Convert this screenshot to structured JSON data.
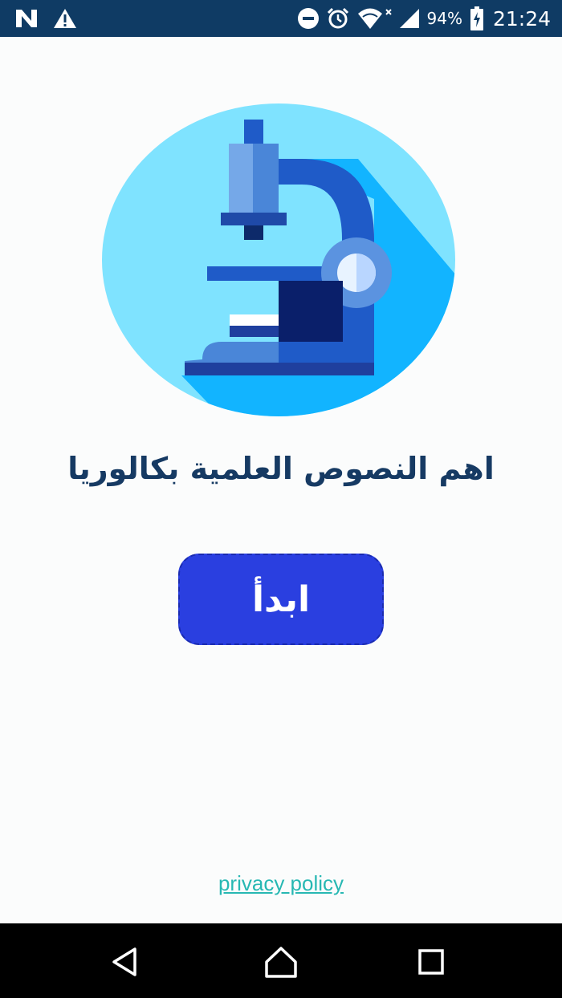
{
  "status_bar": {
    "battery_percent": "94%",
    "time": "21:24",
    "icons": [
      "n-logo-icon",
      "warning-icon",
      "do-not-disturb-icon",
      "alarm-icon",
      "wifi-icon",
      "cellular-signal-icon",
      "battery-charging-icon"
    ]
  },
  "hero": {
    "icon": "microscope-icon"
  },
  "main": {
    "title": "اهم النصوص العلمية بكالوريا",
    "start_label": "ابدأ",
    "privacy_label": "privacy policy"
  },
  "nav_bar": {
    "icons": [
      "back-icon",
      "home-icon",
      "recents-icon"
    ]
  },
  "colors": {
    "status_bar": "#0f3b64",
    "background": "#fbfcfc",
    "title": "#163a63",
    "button": "#2a3fe0",
    "link": "#27b8b3",
    "circle": "#7fe3ff",
    "circle_shadow": "#12b4ff"
  }
}
